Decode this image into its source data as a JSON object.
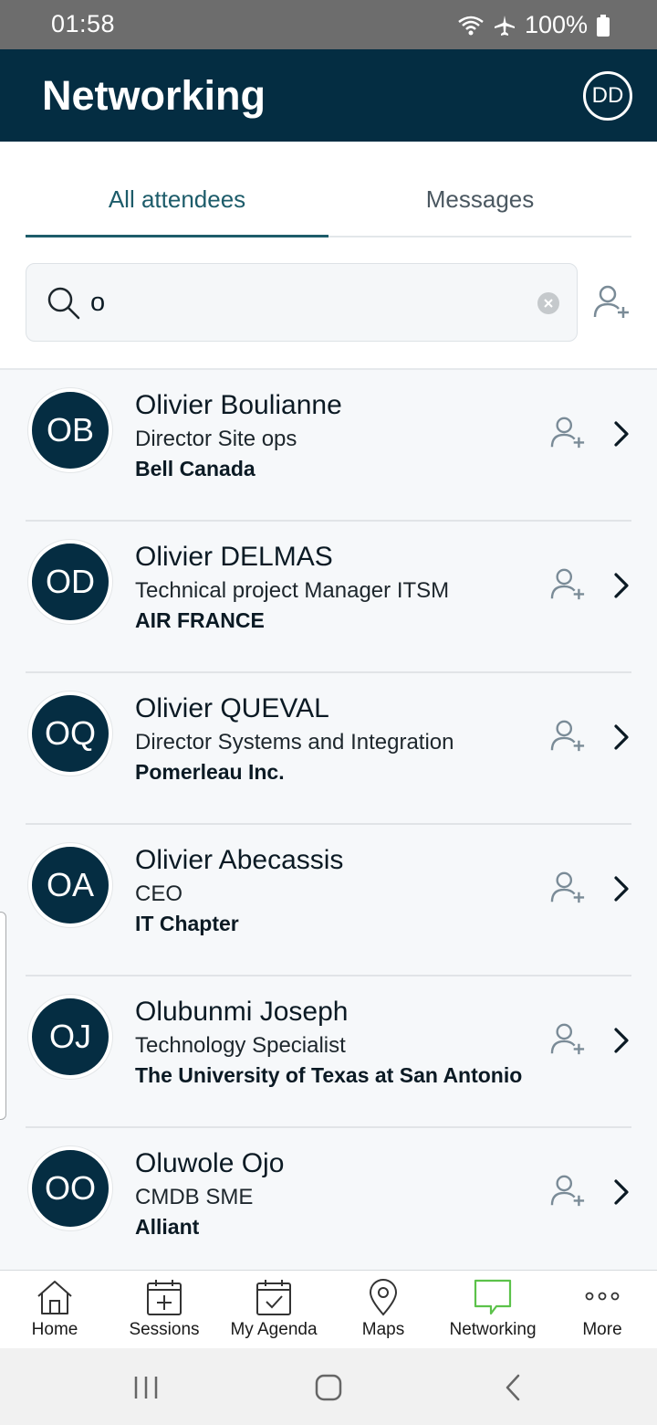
{
  "status_bar": {
    "time": "01:58",
    "battery": "100%"
  },
  "header": {
    "title": "Networking",
    "avatar_initials": "DD"
  },
  "tabs": [
    {
      "label": "All attendees",
      "active": true
    },
    {
      "label": "Messages",
      "active": false
    }
  ],
  "search": {
    "value": "o",
    "placeholder": ""
  },
  "attendees": [
    {
      "initials": "OB",
      "name": "Olivier Boulianne",
      "title": "Director Site ops",
      "company": "Bell Canada"
    },
    {
      "initials": "OD",
      "name": "Olivier DELMAS",
      "title": "Technical project Manager ITSM",
      "company": "AIR FRANCE"
    },
    {
      "initials": "OQ",
      "name": "Olivier QUEVAL",
      "title": "Director Systems and Integration",
      "company": "Pomerleau Inc."
    },
    {
      "initials": "OA",
      "name": "Olivier Abecassis",
      "title": "CEO",
      "company": "IT Chapter"
    },
    {
      "initials": "OJ",
      "name": "Olubunmi Joseph",
      "title": "Technology Specialist",
      "company": "The University of Texas at San Antonio"
    },
    {
      "initials": "OO",
      "name": "Oluwole Ojo",
      "title": "CMDB SME",
      "company": "Alliant"
    }
  ],
  "bottom_nav": [
    {
      "label": "Home",
      "icon": "home-icon"
    },
    {
      "label": "Sessions",
      "icon": "calendar-plus-icon"
    },
    {
      "label": "My Agenda",
      "icon": "calendar-check-icon"
    },
    {
      "label": "Maps",
      "icon": "map-pin-icon"
    },
    {
      "label": "Networking",
      "icon": "chat-bubble-icon",
      "active": true
    },
    {
      "label": "More",
      "icon": "more-dots-icon"
    }
  ],
  "colors": {
    "header_bg": "#042d42",
    "accent": "#1d5c6a",
    "nav_active": "#5cc24a",
    "avatar_bg": "#052d42"
  }
}
